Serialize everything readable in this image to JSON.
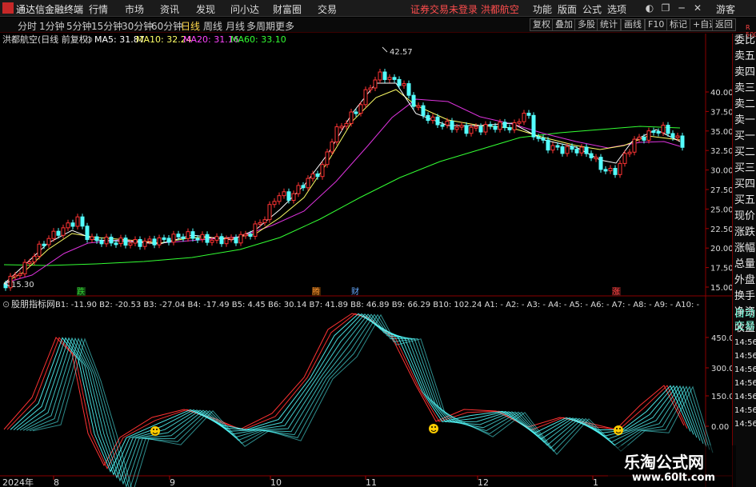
{
  "titlebar": {
    "app": "通达信金融终端",
    "menus": [
      "行情",
      "市场",
      "资讯",
      "发现",
      "问小达",
      "财富圈",
      "交易"
    ],
    "login": "证券交易未登录 洪都航空",
    "right": [
      "功能",
      "版面",
      "公式",
      "选项"
    ],
    "guest": "游客"
  },
  "periods": [
    "分时",
    "1分钟",
    "5分钟",
    "15分钟",
    "30分钟",
    "60分钟",
    "日线",
    "周线",
    "月线",
    "多周期",
    "更多"
  ],
  "active_period": "日线",
  "toolbar_right": [
    "复权",
    "叠加",
    "多股",
    "统计",
    "画线",
    "F10",
    "标记",
    "+自选",
    "返回"
  ],
  "main_legend": {
    "stock": "洪都航空(日线 前复权)",
    "ma5": "MA5: 31.87",
    "ma10": "MA10: 32.24",
    "ma20": "MA20: 31.16",
    "ma60": "MA60: 33.10"
  },
  "price_axis": [
    "40.00",
    "37.50",
    "35.00",
    "32.50",
    "30.00",
    "27.50",
    "25.00",
    "22.50",
    "20.00",
    "17.50",
    "15.00"
  ],
  "high_label": "42.57",
  "low_label": "15.30",
  "event_tags": [
    {
      "t": "跌",
      "c": "#33cc33"
    },
    {
      "t": "腾",
      "c": "#ff9933"
    },
    {
      "t": "财",
      "c": "#66aaff"
    },
    {
      "t": "涨",
      "c": "#ff4444"
    }
  ],
  "sub_legend": {
    "name": "股朋指标网",
    "vals": "B1: -11.90 B2: -20.53 B3: -27.04 B4: -17.49 B5: 4.45 B6: 30.14 B7: 41.89 B8: 46.89 B9: 66.29 B10: 102.24 A1: - A2: - A3: - A4: - A5: - A6: - A7: - A8: - A9: - A10: -"
  },
  "sub_axis": [
    "450.0",
    "300.0",
    "150.0",
    "0.00"
  ],
  "date_axis": [
    "2024年",
    "8",
    "9",
    "10",
    "11",
    "12",
    "1"
  ],
  "right_panel": [
    "委比",
    "卖五",
    "卖四",
    "卖三",
    "卖二",
    "卖一",
    "买一",
    "买二",
    "买三",
    "买四",
    "买五",
    "现价",
    "涨跌",
    "涨幅",
    "总量",
    "外盘",
    "换手",
    "净资",
    "收益",
    "自动",
    "交易",
    "14:56",
    "14:56",
    "14:56",
    "14:56",
    "14:56",
    "14:56",
    "14:56"
  ],
  "corner_tag": "R 500",
  "watermark": {
    "main": "乐淘公式网",
    "sub": "www.60lt.com"
  },
  "colors": {
    "up": "#ff3333",
    "down": "#54ffff",
    "ma5": "#ffffff",
    "ma10": "#ffff66",
    "ma20": "#ff44ff",
    "ma60": "#33ff33"
  }
}
